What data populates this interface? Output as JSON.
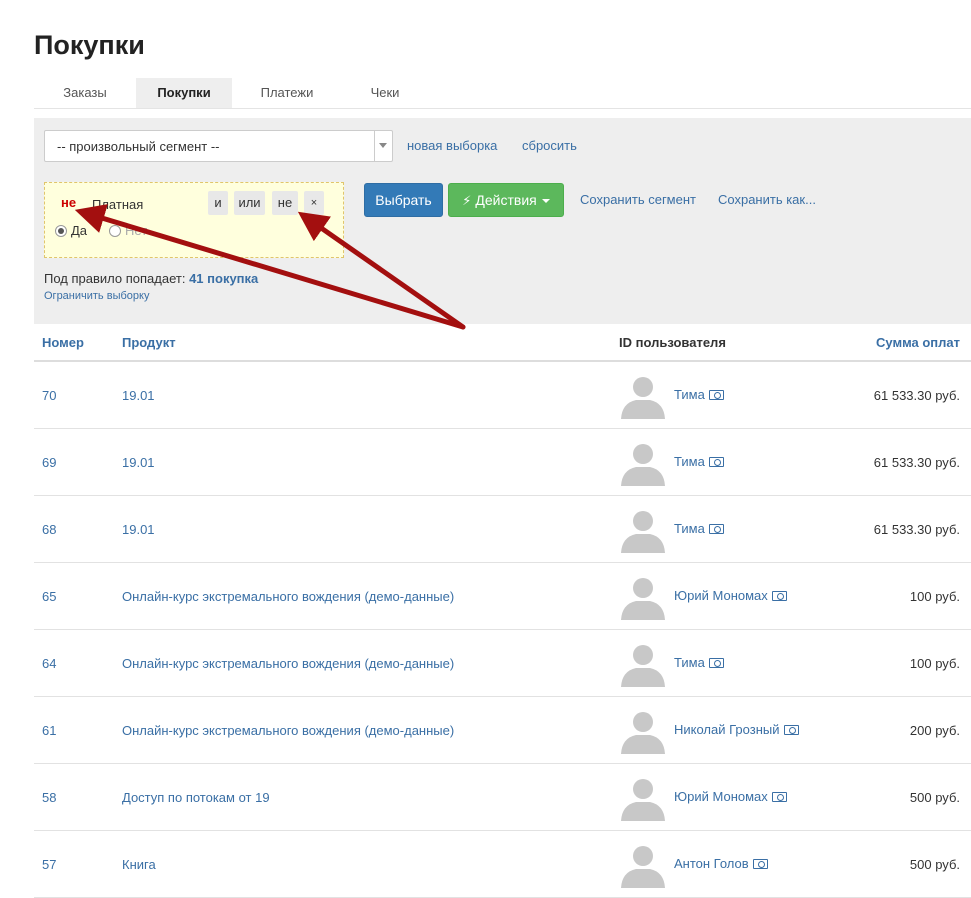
{
  "page": {
    "title": "Покупки"
  },
  "tabs": [
    {
      "label": "Заказы"
    },
    {
      "label": "Покупки"
    },
    {
      "label": "Платежи"
    },
    {
      "label": "Чеки"
    }
  ],
  "filter": {
    "segment_value": "-- произвольный сегмент --",
    "new_selection": "новая выборка",
    "reset": "сбросить",
    "condition": {
      "negation": "не",
      "label": "Платная",
      "op_and": "и",
      "op_or": "или",
      "op_not": "не",
      "op_remove": "×",
      "yes": "Да",
      "no": "Нет"
    },
    "select_button": "Выбрать",
    "actions_button": "Действия",
    "save_segment": "Сохранить сегмент",
    "save_as": "Сохранить как...",
    "rule_prefix": "Под правило попадает:",
    "rule_count": "41 покупка",
    "limit_selection": "Ограничить выборку"
  },
  "table": {
    "headers": {
      "number": "Номер",
      "product": "Продукт",
      "user_id": "ID пользователя",
      "sum": "Сумма оплат"
    },
    "rows": [
      {
        "number": "70",
        "product": "19.01",
        "user": "Тима",
        "sum": "61 533.30 руб."
      },
      {
        "number": "69",
        "product": "19.01",
        "user": "Тима",
        "sum": "61 533.30 руб."
      },
      {
        "number": "68",
        "product": "19.01",
        "user": "Тима",
        "sum": "61 533.30 руб."
      },
      {
        "number": "65",
        "product": "Онлайн-курс экстремального вождения (демо-данные)",
        "user": "Юрий Мономах",
        "sum": "100 руб."
      },
      {
        "number": "64",
        "product": "Онлайн-курс экстремального вождения (демо-данные)",
        "user": "Тима",
        "sum": "100 руб."
      },
      {
        "number": "61",
        "product": "Онлайн-курс экстремального вождения (демо-данные)",
        "user": "Николай Грозный",
        "sum": "200 руб."
      },
      {
        "number": "58",
        "product": "Доступ по потокам от 19",
        "user": "Юрий Мономах",
        "sum": "500 руб."
      },
      {
        "number": "57",
        "product": "Книга",
        "user": "Антон Голов",
        "sum": "500 руб."
      }
    ]
  },
  "colors": {
    "link": "#3a6fa5",
    "primary_button": "#337ab7",
    "success_button": "#5cb85c",
    "negation": "#cc0000",
    "annotation_arrow": "#a30f0f"
  }
}
